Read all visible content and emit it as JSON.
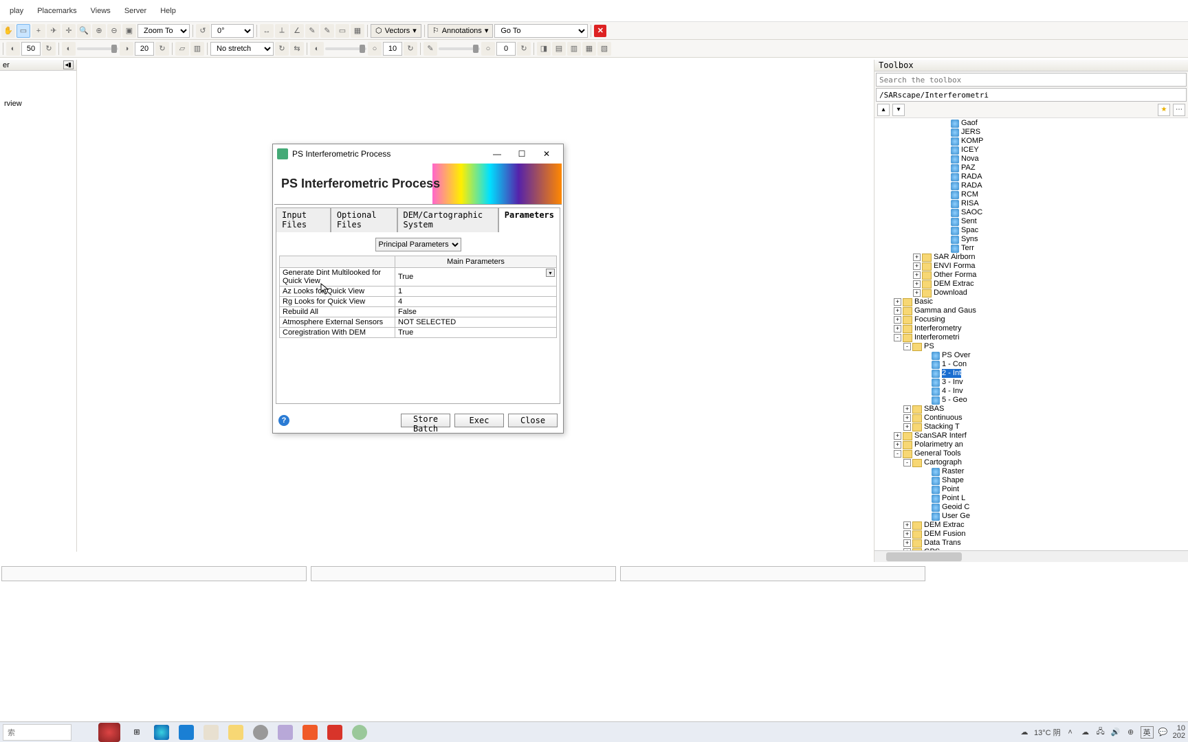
{
  "menu": {
    "items": [
      "play",
      "Placemarks",
      "Views",
      "Server",
      "Help"
    ]
  },
  "toolbar1": {
    "zoom_to": "Zoom To",
    "rotate": "0°",
    "vectors": "Vectors",
    "annotations": "Annotations",
    "go_to": "Go To"
  },
  "toolbar2": {
    "val50": "50",
    "val20": "20",
    "stretch": "No stretch",
    "val10": "10",
    "val0": "0"
  },
  "left_panel": {
    "title": "er",
    "item": "rview"
  },
  "toolbox": {
    "title": "Toolbox",
    "search_placeholder": "Search the toolbox",
    "path": "/SARscape/Interferometri",
    "sensors": [
      "Gaof",
      "JERS",
      "KOMP",
      "ICEY",
      "Nova",
      "PAZ",
      "RADA",
      "RADA",
      "RCM",
      "RISA",
      "SAOC",
      "Sent",
      "Spac",
      "Syns",
      "Terr"
    ],
    "folders": [
      {
        "label": "SAR Airborn",
        "exp": "+"
      },
      {
        "label": "ENVI Forma",
        "exp": "+"
      },
      {
        "label": "Other Forma",
        "exp": "+"
      },
      {
        "label": "DEM Extrac",
        "exp": "+"
      },
      {
        "label": "Download",
        "exp": "+"
      }
    ],
    "cats": [
      {
        "label": "Basic",
        "exp": "+"
      },
      {
        "label": "Gamma and Gaus",
        "exp": "+"
      },
      {
        "label": "Focusing",
        "exp": "+"
      },
      {
        "label": "Interferometry",
        "exp": "+"
      },
      {
        "label": "Interferometri",
        "exp": "-"
      }
    ],
    "ps": {
      "label": "PS",
      "items": [
        {
          "label": "PS Over",
          "sel": false
        },
        {
          "label": "1 - Con",
          "sel": false
        },
        {
          "label": "2 - Int",
          "sel": true
        },
        {
          "label": "3 - Inv",
          "sel": false
        },
        {
          "label": "4 - Inv",
          "sel": false
        },
        {
          "label": "5 - Geo",
          "sel": false
        }
      ]
    },
    "after_ps": [
      {
        "label": "SBAS",
        "exp": "+"
      },
      {
        "label": "Continuous",
        "exp": "+"
      },
      {
        "label": "Stacking T",
        "exp": "+"
      }
    ],
    "more_cats": [
      {
        "label": "ScanSAR Interf",
        "exp": "+"
      },
      {
        "label": "Polarimetry an",
        "exp": "+"
      },
      {
        "label": "General Tools",
        "exp": "-"
      }
    ],
    "cartograph": {
      "label": "Cartograph",
      "items": [
        "Raster",
        "Shape",
        "Point",
        "Point L",
        "Geoid C",
        "User Ge"
      ]
    },
    "tail": [
      {
        "label": "DEM Extrac",
        "exp": "+"
      },
      {
        "label": "DEM Fusion",
        "exp": "+"
      },
      {
        "label": "Data Trans",
        "exp": "+"
      },
      {
        "label": "GPS",
        "exp": "+"
      }
    ]
  },
  "dialog": {
    "title": "PS Interferometric Process",
    "banner_title": "PS Interferometric Process",
    "tabs": [
      "Input Files",
      "Optional Files",
      "DEM/Cartographic System",
      "Parameters"
    ],
    "active_tab": 3,
    "param_group": "Principal Parameters",
    "table_header_blank": "",
    "table_header_main": "Main Parameters",
    "rows": [
      {
        "name": "Generate Dint Multilooked for Quick View",
        "value": "True",
        "dd": true
      },
      {
        "name": "Az Looks for Quick View",
        "value": "1"
      },
      {
        "name": "Rg Looks for Quick View",
        "value": "4"
      },
      {
        "name": "Rebuild All",
        "value": "False"
      },
      {
        "name": "Atmosphere External Sensors",
        "value": "NOT SELECTED"
      },
      {
        "name": "Coregistration With DEM",
        "value": "True"
      }
    ],
    "buttons": {
      "store": "Store Batch",
      "exec": "Exec",
      "close": "Close"
    }
  },
  "taskbar": {
    "search": "索",
    "weather": "13°C 阴",
    "ime": "英",
    "time1": "10",
    "time2": "202"
  }
}
